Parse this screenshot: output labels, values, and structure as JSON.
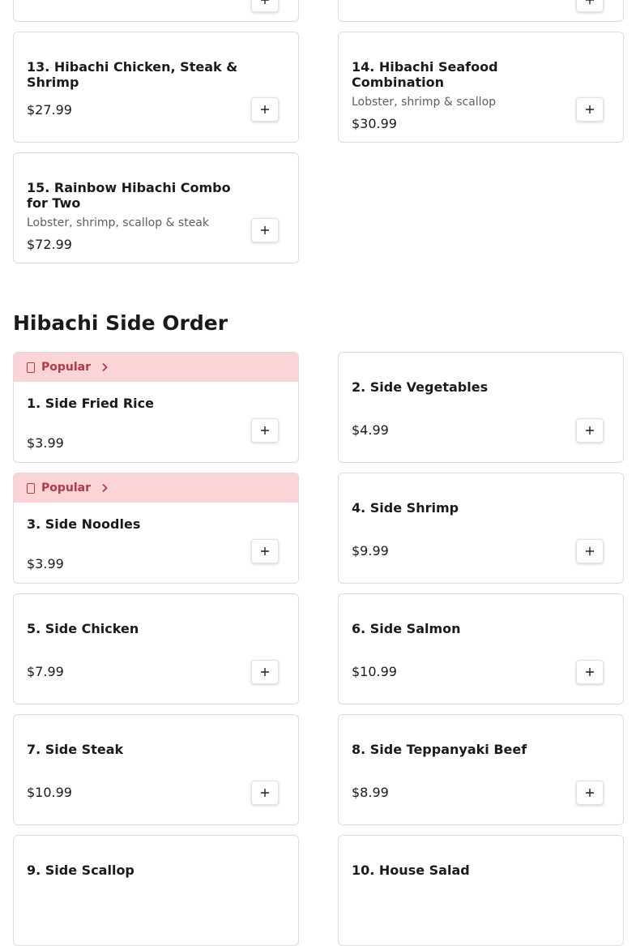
{
  "section": {
    "title": "Hibachi Side Order"
  },
  "popular_label": "Popular",
  "colors": {
    "popular_bg": "#fad4d6",
    "popular_text": "#b03a48",
    "border": "#dcdcdc"
  },
  "top_items": [
    {
      "name": "13. Hibachi Chicken, Steak & Shrimp",
      "description": "",
      "price": "$27.99"
    },
    {
      "name": "14. Hibachi Seafood Combination",
      "description": "Lobster, shrimp & scallop",
      "price": "$30.99"
    },
    {
      "name": "15. Rainbow Hibachi Combo for Two",
      "description": "Lobster, shrimp, scallop & steak",
      "price": "$72.99"
    }
  ],
  "side_items": [
    {
      "name": "1. Side Fried Rice",
      "price": "$3.99",
      "popular": true
    },
    {
      "name": "2. Side Vegetables",
      "price": "$4.99",
      "popular": false
    },
    {
      "name": "3. Side Noodles",
      "price": "$3.99",
      "popular": true
    },
    {
      "name": "4. Side Shrimp",
      "price": "$9.99",
      "popular": false
    },
    {
      "name": "5. Side Chicken",
      "price": "$7.99",
      "popular": false
    },
    {
      "name": "6. Side Salmon",
      "price": "$10.99",
      "popular": false
    },
    {
      "name": "7. Side Steak",
      "price": "$10.99",
      "popular": false
    },
    {
      "name": "8. Side Teppanyaki Beef",
      "price": "$8.99",
      "popular": false
    },
    {
      "name": "9. Side Scallop",
      "price": "",
      "popular": false
    },
    {
      "name": "10. House Salad",
      "price": "",
      "popular": false
    }
  ]
}
